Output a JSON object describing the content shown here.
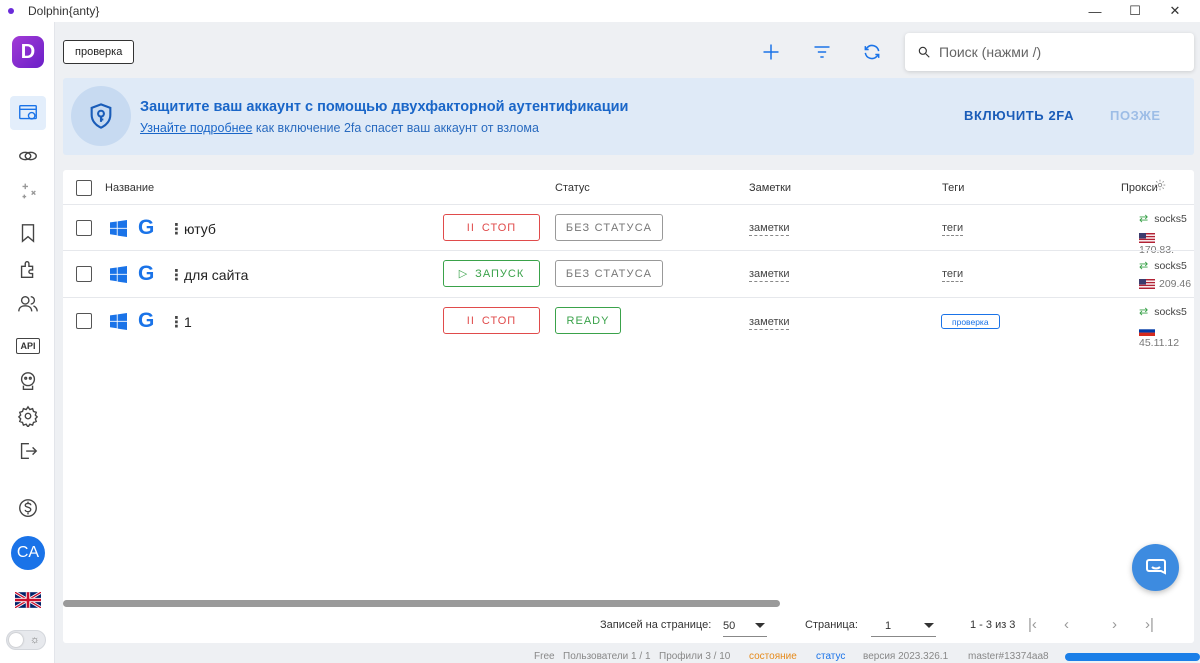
{
  "window": {
    "title": "Dolphin{anty}",
    "minimize": "—",
    "maximize": "☐",
    "close": "✕"
  },
  "sidebar": {
    "logo_letter": "D",
    "avatar_initials": "CA"
  },
  "header": {
    "filter_chip": "проверка",
    "search_placeholder": "Поиск (нажми /)"
  },
  "banner": {
    "title": "Защитите ваш аккаунт с помощью двухфакторной аутентификации",
    "link": "Узнайте подробнее",
    "subtitle_rest": " как включение 2fa спасет ваш аккаунт от взлома",
    "enable_button": "ВКЛЮЧИТЬ 2FA",
    "later_button": "ПОЗЖЕ"
  },
  "table": {
    "columns": {
      "name": "Название",
      "status": "Статус",
      "notes": "Заметки",
      "tags": "Теги",
      "proxy": "Прокси"
    },
    "rows": [
      {
        "name": "ютуб",
        "action": "СТОП",
        "status": "БЕЗ СТАТУСА",
        "notes": "заметки",
        "tags": "теги",
        "proxy_type": "socks5",
        "proxy_ip": "170.83."
      },
      {
        "name": "для сайта",
        "action": "ЗАПУСК",
        "status": "БЕЗ СТАТУСА",
        "notes": "заметки",
        "tags": "теги",
        "proxy_type": "socks5",
        "proxy_ip": "209.46"
      },
      {
        "name": "1",
        "action": "СТОП",
        "status": "READY",
        "notes": "заметки",
        "tags": "проверка",
        "proxy_type": "socks5",
        "proxy_ip": "45.11.12"
      }
    ]
  },
  "pagination": {
    "per_page_label": "Записей на странице:",
    "per_page_value": "50",
    "page_label": "Страница:",
    "page_value": "1",
    "range": "1 - 3 из 3"
  },
  "statusbar": {
    "plan": "Free",
    "users": "Пользователи 1 / 1",
    "profiles": "Профили 3 / 10",
    "state": "состояние",
    "status": "статус",
    "version": "версия 2023.326.1",
    "build": "master#13374aa8"
  },
  "colors": {
    "accent": "#1a73e8",
    "stop": "#e04b4b",
    "start": "#3aa24a",
    "banner_bg": "#dfeaf7"
  }
}
